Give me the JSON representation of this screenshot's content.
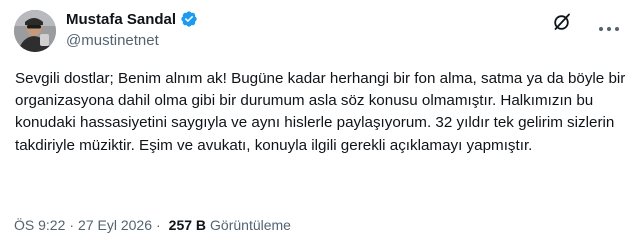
{
  "tweet": {
    "author": {
      "display_name": "Mustafa Sandal",
      "handle": "@mustinetnet",
      "verified": true
    },
    "text": "Sevgili dostlar; Benim alnım ak! Bugüne kadar herhangi bir fon alma, satma ya da böyle bir organizasyona dahil olma gibi bir durumum asla söz konusu olmamıştır. Halkımızın bu konudaki hassasiyetini saygıyla ve aynı hislerle paylaşıyorum. 32 yıldır tek gelirim sizlerin takdiriyle müziktir. Eşim ve avukatı, konuyla ilgili gerekli açıklamayı yapmıştır.",
    "time": "ÖS 9:22",
    "separator": "·",
    "date": "27 Eyl 2026",
    "views_count": "257 B",
    "views_label": "Görüntüleme"
  },
  "colors": {
    "text_primary": "#0f1419",
    "text_secondary": "#536471",
    "verified_blue": "#1d9bf0"
  },
  "icons": {
    "avatar": "profile-photo",
    "verified": "verified-badge-icon",
    "grok": "grok-icon",
    "more": "more-options-icon"
  }
}
